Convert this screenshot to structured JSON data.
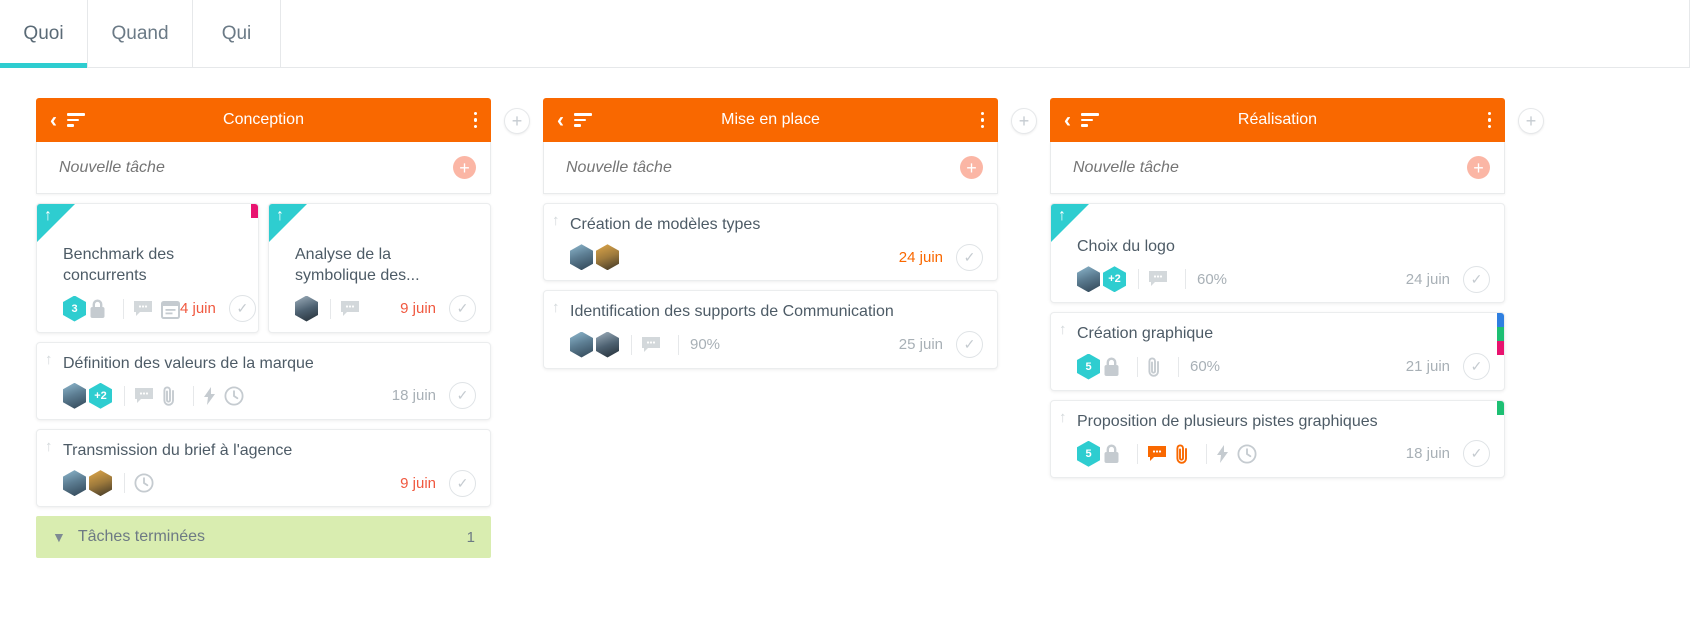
{
  "tabs": [
    {
      "label": "Quoi",
      "active": true
    },
    {
      "label": "Quand",
      "active": false
    },
    {
      "label": "Qui",
      "active": false
    }
  ],
  "board": {
    "new_task_placeholder": "Nouvelle tâche",
    "add_column_label": "+",
    "columns": [
      {
        "title": "Conception",
        "completed": {
          "label": "Tâches terminées",
          "count": "1"
        },
        "cards": [
          {
            "title": "Benchmark des concurrents",
            "badge": "3",
            "date": "4 juin",
            "date_color": "red",
            "percent": "",
            "icons": [
              "lock-icon",
              "comment-icon",
              "note-icon"
            ],
            "avatars": [],
            "extra_avatar": "",
            "ribbon": true,
            "tags": [
              "#e8136f"
            ]
          },
          {
            "title": "Analyse de la symbolique des...",
            "badge": "",
            "date": "9 juin",
            "date_color": "red",
            "percent": "",
            "icons": [
              "comment-icon"
            ],
            "avatars": [
              "av3"
            ],
            "extra_avatar": "",
            "ribbon": true,
            "tags": []
          },
          {
            "title": "Définition des valeurs de la marque",
            "badge": "",
            "date": "18 juin",
            "date_color": "grey",
            "percent": "",
            "icons": [
              "comment-icon",
              "paperclip-icon",
              "bolt-icon",
              "clock-icon"
            ],
            "avatars": [
              "av1"
            ],
            "extra_avatar": "+2",
            "ribbon": false,
            "tags": []
          },
          {
            "title": "Transmission du brief à l'agence",
            "badge": "",
            "date": "9 juin",
            "date_color": "red",
            "percent": "",
            "icons": [
              "clock-icon"
            ],
            "avatars": [
              "av1",
              "av2"
            ],
            "extra_avatar": "",
            "ribbon": false,
            "tags": []
          }
        ]
      },
      {
        "title": "Mise en place",
        "completed": null,
        "cards": [
          {
            "title": "Création de modèles types",
            "badge": "",
            "date": "24 juin",
            "date_color": "orange",
            "percent": "",
            "icons": [],
            "avatars": [
              "av1",
              "av2"
            ],
            "extra_avatar": "",
            "ribbon": false,
            "tags": []
          },
          {
            "title": "Identification des supports de Communication",
            "badge": "",
            "date": "25 juin",
            "date_color": "grey",
            "percent": "90%",
            "icons": [
              "comment-icon"
            ],
            "avatars": [
              "av1",
              "av3"
            ],
            "extra_avatar": "",
            "ribbon": false,
            "tags": []
          }
        ]
      },
      {
        "title": "Réalisation",
        "completed": null,
        "cards": [
          {
            "title": "Choix du logo",
            "badge": "",
            "date": "24 juin",
            "date_color": "grey",
            "percent": "60%",
            "icons": [
              "comment-icon"
            ],
            "avatars": [
              "av1"
            ],
            "extra_avatar": "+2",
            "ribbon": true,
            "tags": []
          },
          {
            "title": "Création graphique",
            "badge": "5",
            "date": "21 juin",
            "date_color": "grey",
            "percent": "60%",
            "icons": [
              "lock-icon",
              "paperclip-icon"
            ],
            "avatars": [],
            "extra_avatar": "",
            "ribbon": false,
            "tags": [
              "#2f7fe0",
              "#1dbf73",
              "#e8136f"
            ]
          },
          {
            "title": "Proposition de plusieurs pistes graphiques",
            "badge": "5",
            "date": "18 juin",
            "date_color": "grey",
            "percent": "",
            "icons": [
              "lock-icon",
              "comment-orange-icon",
              "paperclip-orange-icon",
              "bolt-icon",
              "clock-icon"
            ],
            "avatars": [],
            "extra_avatar": "",
            "ribbon": false,
            "tags": [
              "#1dbf73"
            ]
          }
        ]
      }
    ]
  },
  "colors": {
    "header_orange": "#f96800",
    "accent_teal": "#2ecdd0",
    "completed_green": "#d9edb0",
    "overdue_red": "#f0583f"
  }
}
